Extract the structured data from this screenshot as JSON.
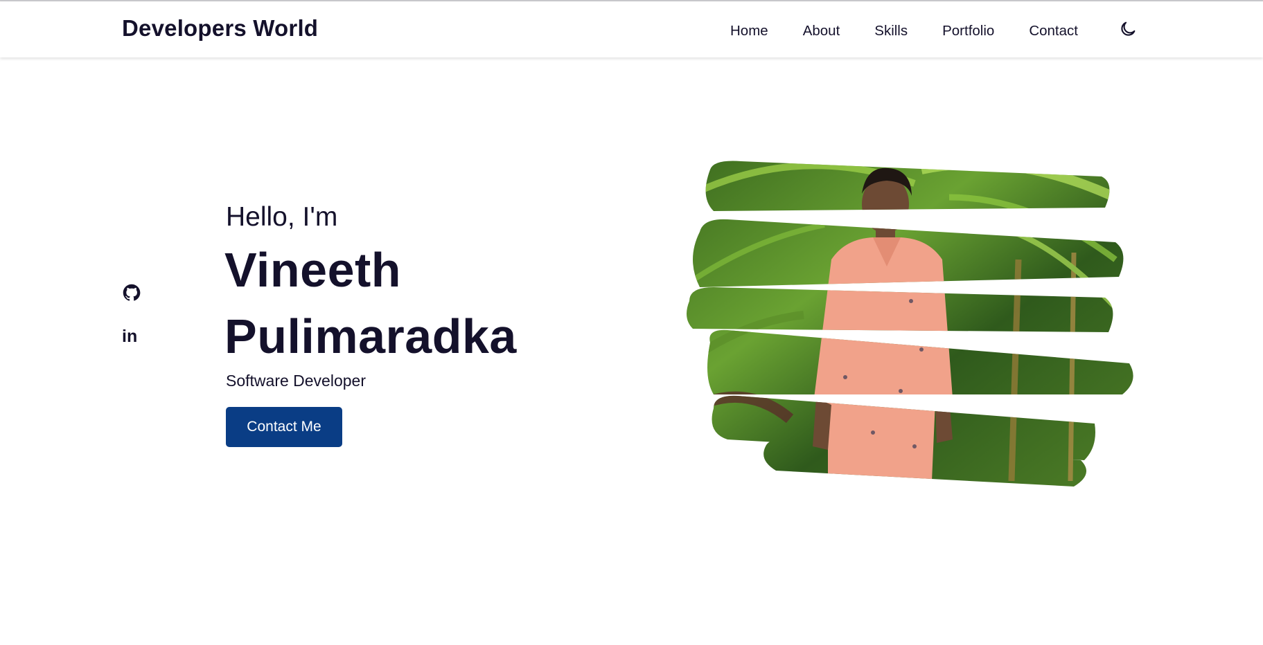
{
  "header": {
    "logo": "Developers World",
    "nav": [
      "Home",
      "About",
      "Skills",
      "Portfolio",
      "Contact"
    ],
    "theme_toggle_icon": "moon-icon"
  },
  "social": {
    "github_icon": "github-icon",
    "linkedin_icon": "linkedin-icon",
    "linkedin_glyph": "in"
  },
  "hero": {
    "greeting": "Hello, I'm",
    "name_first": "Vineeth",
    "name_last": "Pulimaradka",
    "role": "Software Developer",
    "cta_label": "Contact Me"
  },
  "colors": {
    "text": "#14112b",
    "accent": "#0a3d85",
    "background": "#ffffff"
  }
}
